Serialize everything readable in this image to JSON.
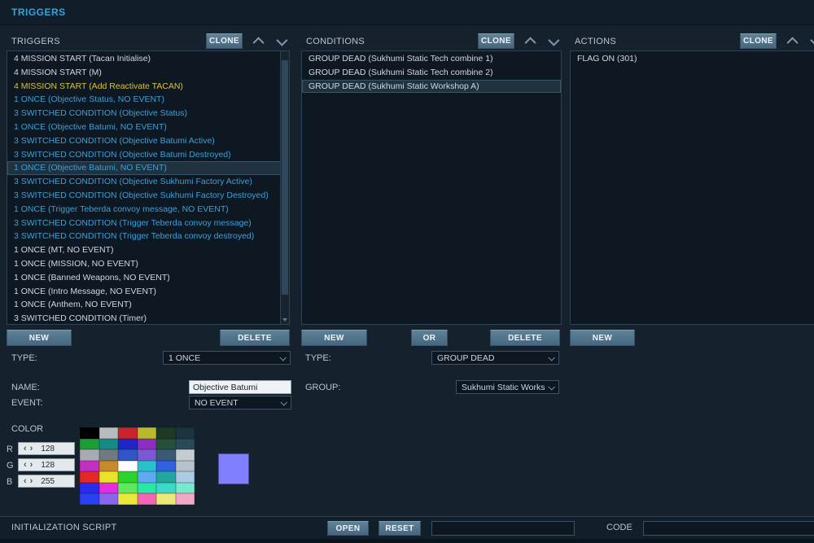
{
  "window": {
    "title": "TRIGGERS"
  },
  "columns": {
    "triggers": {
      "header": "TRIGGERS",
      "clone_label": "CLONE",
      "new_label": "NEW",
      "delete_label": "DELETE",
      "items": [
        {
          "text": "4 MISSION START (Tacan Initialise)",
          "color": "white",
          "selected": false
        },
        {
          "text": "4 MISSION START (M)",
          "color": "white",
          "selected": false
        },
        {
          "text": "4 MISSION START (Add Reactivate TACAN)",
          "color": "yellow",
          "selected": false
        },
        {
          "text": "1 ONCE (Objective Status, NO EVENT)",
          "color": "blue",
          "selected": false
        },
        {
          "text": "3 SWITCHED CONDITION (Objective Status)",
          "color": "blue",
          "selected": false
        },
        {
          "text": "1 ONCE (Objective Batumi, NO EVENT)",
          "color": "blue",
          "selected": false
        },
        {
          "text": "3 SWITCHED CONDITION (Objective Batumi Active)",
          "color": "blue",
          "selected": false
        },
        {
          "text": "3 SWITCHED CONDITION (Objective Batumi Destroyed)",
          "color": "blue",
          "selected": false
        },
        {
          "text": "1 ONCE (Objective Batumi, NO EVENT)",
          "color": "blue",
          "selected": true
        },
        {
          "text": "3 SWITCHED CONDITION (Objective Sukhumi Factory Active)",
          "color": "blue",
          "selected": false
        },
        {
          "text": "3 SWITCHED CONDITION (Objective Sukhumi Factory Destroyed)",
          "color": "blue",
          "selected": false
        },
        {
          "text": "1 ONCE (Trigger Teberda  convoy message, NO EVENT)",
          "color": "blue",
          "selected": false
        },
        {
          "text": "3 SWITCHED CONDITION (Trigger Teberda  convoy message)",
          "color": "blue",
          "selected": false
        },
        {
          "text": "3 SWITCHED CONDITION (Trigger Teberda  convoy destroyed)",
          "color": "blue",
          "selected": false
        },
        {
          "text": "1 ONCE (MT, NO EVENT)",
          "color": "white",
          "selected": false
        },
        {
          "text": "1 ONCE (MISSION, NO EVENT)",
          "color": "white",
          "selected": false
        },
        {
          "text": "1 ONCE (Banned Weapons, NO EVENT)",
          "color": "white",
          "selected": false
        },
        {
          "text": "1 ONCE (Intro Message, NO EVENT)",
          "color": "white",
          "selected": false
        },
        {
          "text": "1 ONCE (Anthem, NO EVENT)",
          "color": "white",
          "selected": false
        },
        {
          "text": "3 SWITCHED CONDITION (Timer)",
          "color": "white",
          "selected": false
        }
      ]
    },
    "conditions": {
      "header": "CONDITIONS",
      "clone_label": "CLONE",
      "new_label": "NEW",
      "or_label": "OR",
      "delete_label": "DELETE",
      "items": [
        {
          "text": "GROUP DEAD (Sukhumi Static Tech combine 1)",
          "color": "white",
          "selected": false
        },
        {
          "text": "GROUP DEAD (Sukhumi Static Tech combine 2)",
          "color": "white",
          "selected": false
        },
        {
          "text": "GROUP DEAD (Sukhumi Static Workshop A)",
          "color": "white",
          "selected": true
        }
      ]
    },
    "actions": {
      "header": "ACTIONS",
      "clone_label": "CLONE",
      "new_label": "NEW",
      "items": [
        {
          "text": "FLAG ON (301)",
          "color": "white",
          "selected": false
        }
      ]
    }
  },
  "trigger_form": {
    "type_label": "TYPE:",
    "type_value": "1 ONCE",
    "name_label": "NAME:",
    "name_value": "Objective Batumi",
    "event_label": "EVENT:",
    "event_value": "NO EVENT"
  },
  "condition_form": {
    "type_label": "TYPE:",
    "type_value": "GROUP DEAD",
    "group_label": "GROUP:",
    "group_value": "Sukhumi Static Works"
  },
  "color_section": {
    "label": "COLOR",
    "r_label": "R",
    "r_value": "128",
    "g_label": "G",
    "g_value": "128",
    "b_label": "B",
    "b_value": "255",
    "decrement_glyph": "‹",
    "increment_glyph": "›",
    "preview_color": "#8080ff",
    "palette": [
      [
        "#000000",
        "#b9bcbe",
        "#c9242c",
        "#b9b92a",
        "#1d3a24",
        "#1b3540"
      ],
      [
        "#1d9e35",
        "#168a84",
        "#2026c4",
        "#8c2fc0",
        "#25503c",
        "#2a4a58"
      ],
      [
        "#a6adb2",
        "#6f7a82",
        "#2f55c9",
        "#7e57d2",
        "#3a5a74",
        "#c3ccd2"
      ],
      [
        "#c32ec3",
        "#c78a2a",
        "#ffffff",
        "#29c2cc",
        "#2f62e0",
        "#b7c3cc"
      ],
      [
        "#e32726",
        "#e8e32b",
        "#2cd32c",
        "#5ea9f2",
        "#22a69e",
        "#a9cbe4"
      ],
      [
        "#2b2bee",
        "#e22ee2",
        "#5fe95f",
        "#27e8a5",
        "#3cd9c8",
        "#79e9cc"
      ],
      [
        "#2a41f2",
        "#8a66ee",
        "#e9e93c",
        "#f565b6",
        "#e9e978",
        "#f2a8c6"
      ]
    ]
  },
  "bottom_bar": {
    "label": "INITIALIZATION SCRIPT",
    "open_label": "OPEN",
    "reset_label": "RESET",
    "script_value": "",
    "code_label": "CODE",
    "code_value": ""
  }
}
